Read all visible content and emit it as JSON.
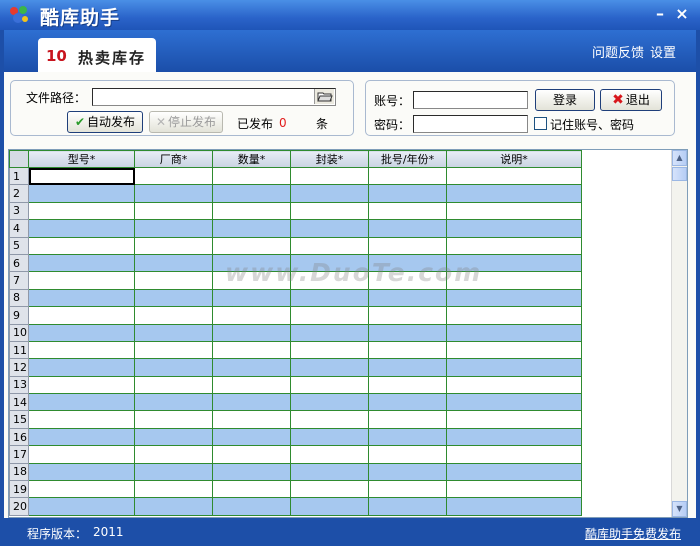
{
  "window": {
    "title": "酷库助手",
    "minimize": "–",
    "close": "×"
  },
  "tab": {
    "logo": "10",
    "label": "热卖库存"
  },
  "top_links": {
    "feedback": "问题反馈",
    "settings": "设置"
  },
  "publish": {
    "path_label": "文件路径：",
    "path_value": "",
    "auto_publish": "自动发布",
    "stop_publish": "停止发布",
    "published_label": "已发布",
    "published_count": "0",
    "unit": "条"
  },
  "login": {
    "account_label": "账号：",
    "password_label": "密码：",
    "account_value": "",
    "password_value": "",
    "login_button": "登录",
    "exit_button": "退出",
    "remember": "记住账号、密码",
    "remember_checked": false
  },
  "grid": {
    "columns": [
      "型号*",
      "厂商*",
      "数量*",
      "封装*",
      "批号/年份*",
      "说明*"
    ],
    "row_numbers": [
      "1",
      "2",
      "3",
      "4",
      "5",
      "6",
      "7",
      "8",
      "9",
      "10",
      "11",
      "12",
      "13",
      "14",
      "15",
      "16",
      "17",
      "18",
      "19",
      "20"
    ]
  },
  "watermark": "www.DuoTe.com",
  "status": {
    "version_label": "程序版本：",
    "version_value": "2011",
    "free_link": "酷库助手免费发布"
  },
  "colors": {
    "title_bar": "#2a63c9",
    "row_alt": "#a6c8ef",
    "grid_line": "#2f8b2f",
    "count": "#e21b1b"
  }
}
